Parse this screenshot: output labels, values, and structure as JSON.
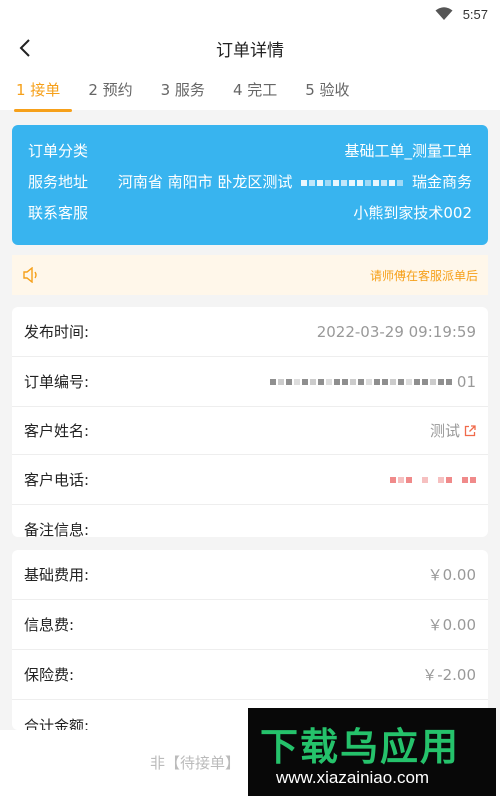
{
  "status": {
    "time": "5:57"
  },
  "nav": {
    "title": "订单详情"
  },
  "tabs": [
    {
      "label": "1 接单",
      "active": true
    },
    {
      "label": "2 预约",
      "active": false
    },
    {
      "label": "3 服务",
      "active": false
    },
    {
      "label": "4 完工",
      "active": false
    },
    {
      "label": "5 验收",
      "active": false
    }
  ],
  "summary": {
    "category_label": "订单分类",
    "category_value": "基础工单_测量工单",
    "address_label": "服务地址",
    "address_prefix": "河南省 南阳市 卧龙区测试",
    "address_suffix": "瑞金商务",
    "contact_label": "联系客服",
    "contact_value": "小熊到家技术002"
  },
  "notice": {
    "text": "请师傅在客服派单后"
  },
  "details": {
    "publish_label": "发布时间:",
    "publish_value": "2022-03-29 09:19:59",
    "order_no_label": "订单编号:",
    "order_no_suffix": "01",
    "customer_name_label": "客户姓名:",
    "customer_name_value": "测试",
    "customer_phone_label": "客户电话:",
    "remark_label": "备注信息:",
    "remark_value": ""
  },
  "fees": {
    "base_label": "基础费用:",
    "base_value": "￥0.00",
    "info_label": "信息费:",
    "info_value": "￥0.00",
    "insurance_label": "保险费:",
    "insurance_value": "￥-2.00",
    "total_label": "合计金额:"
  },
  "bottom": {
    "hint": "非【待接单】"
  },
  "watermark": {
    "title": "下载乌应用",
    "url": "www.xiazainiao.com"
  },
  "colors": {
    "accent": "#f6a01a",
    "card_blue": "#38b4ef",
    "watermark_green": "#25c26b"
  }
}
